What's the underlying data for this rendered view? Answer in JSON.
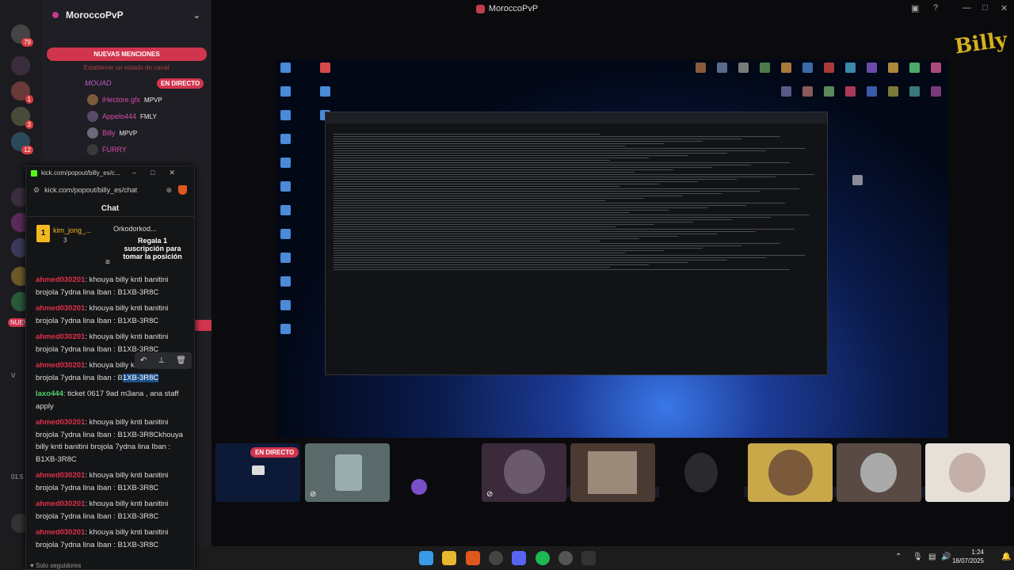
{
  "window": {
    "title": "MoroccoPvP"
  },
  "server": {
    "name": "MoroccoPvP",
    "mentions_button": "NUEVAS MENCIONES",
    "status_link": "Establecer un estado de canal",
    "voice_channel": "MOUAD",
    "live_label": "EN DIRECTO",
    "members": [
      {
        "name": "iHectore.gfx",
        "tag": "MPVP"
      },
      {
        "name": "Appelo444",
        "tag": "FMLY"
      },
      {
        "name": "Billy",
        "tag": "MPVP"
      },
      {
        "name": "FURRY",
        "tag": ""
      }
    ],
    "rail_badges": [
      "79",
      "1",
      "3",
      "12"
    ],
    "rail_left_labels": [
      "NUEV",
      "V",
      "01:5"
    ]
  },
  "logo": {
    "text": "Billy"
  },
  "tiles": {
    "live_label": "EN DIRECTO"
  },
  "kick": {
    "window_title": "kick.com/popout/billy_es/c...",
    "url": "kick.com/popout/billy_es/chat",
    "chat_title": "Chat",
    "top_user": {
      "rank": "1",
      "name": "kim_jong_...",
      "count": "3"
    },
    "gift_user": "Orkodorkod...",
    "gift_text": "Regala 1 suscripción para tomar la posición",
    "messages": [
      {
        "user": "ahmed030201",
        "text": ": khouya billy knti banitini brojola 7ydna lina Iban : B1XB-3R8C",
        "green": false
      },
      {
        "user": "ahmed030201",
        "text": ": khouya billy knti banitini brojola 7ydna lina Iban : B1XB-3R8C",
        "green": false
      },
      {
        "user": "ahmed030201",
        "text": ": khouya billy knti banitini brojola 7ydna lina Iban : B1XB-3R8C",
        "green": false
      },
      {
        "user": "ahmed030201",
        "text_pre": ": khouya billy kn",
        "text_mid": "brojola 7ydna lina Iban : B",
        "text_hl": "1XB-3R8C",
        "green": false
      },
      {
        "user": "laxo444",
        "text": ": ticket 0617 9ad m3ana , ana staff apply",
        "green": true
      },
      {
        "user": "ahmed030201",
        "text": ": khouya billy knti banitini brojola 7ydna lina Iban : B1XB-3R8Ckhouya billy knti banitini brojola 7ydna lina Iban : B1XB-3R8C",
        "green": false
      },
      {
        "user": "ahmed030201",
        "text": ": khouya billy knti banitini brojola 7ydna lina Iban : B1XB-3R8C",
        "green": false
      },
      {
        "user": "ahmed030201",
        "text": ": khouya billy knti banitini brojola 7ydna lina Iban : B1XB-3R8C",
        "green": false
      },
      {
        "user": "ahmed030201",
        "text": ": khouya billy knti banitini brojola 7ydna lina Iban : B1XB-3R8C",
        "green": false
      }
    ],
    "followers_only": "Solo seguidores"
  },
  "taskbar": {
    "time": "1:24",
    "date": "18/07/2025"
  }
}
